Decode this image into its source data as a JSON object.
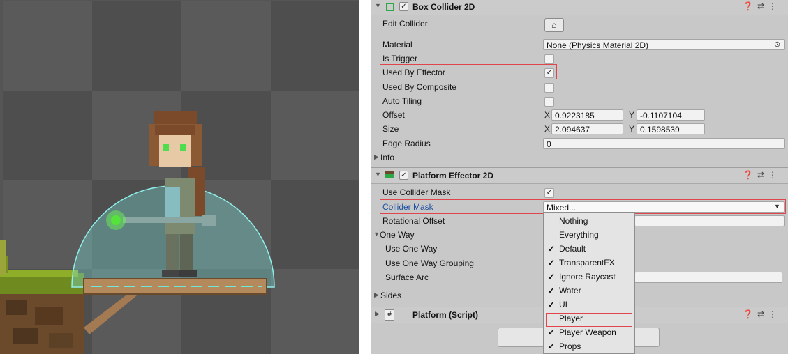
{
  "box_collider": {
    "title": "Box Collider 2D",
    "edit_collider": "Edit Collider",
    "material_label": "Material",
    "material_value": "None (Physics Material 2D)",
    "is_trigger": "Is Trigger",
    "used_by_effector": "Used By Effector",
    "used_by_composite": "Used By Composite",
    "auto_tiling": "Auto Tiling",
    "offset_label": "Offset",
    "offset_x": "0.9223185",
    "offset_y": "-0.1107104",
    "size_label": "Size",
    "size_x": "2.094637",
    "size_y": "0.1598539",
    "edge_radius_label": "Edge Radius",
    "edge_radius_value": "0",
    "info": "Info",
    "x": "X",
    "y": "Y",
    "check": "✓"
  },
  "platform_effector": {
    "title": "Platform Effector 2D",
    "use_collider_mask": "Use Collider Mask",
    "collider_mask": "Collider Mask",
    "collider_mask_value": "Mixed...",
    "rotational_offset": "Rotational Offset",
    "one_way": "One Way",
    "use_one_way": "Use One Way",
    "use_one_way_grouping": "Use One Way Grouping",
    "surface_arc": "Surface Arc",
    "sides": "Sides"
  },
  "platform_script": {
    "title": "Platform (Script)"
  },
  "dropdown": {
    "items": [
      {
        "label": "Nothing",
        "checked": false
      },
      {
        "label": "Everything",
        "checked": false
      },
      {
        "label": "Default",
        "checked": true
      },
      {
        "label": "TransparentFX",
        "checked": true
      },
      {
        "label": "Ignore Raycast",
        "checked": true
      },
      {
        "label": "Water",
        "checked": true
      },
      {
        "label": "UI",
        "checked": true
      },
      {
        "label": "Player",
        "checked": false
      },
      {
        "label": "Player Weapon",
        "checked": true
      },
      {
        "label": "Props",
        "checked": true
      }
    ]
  },
  "colors": {
    "highlight": "#e0444c",
    "collider_gizmo": "#7fe6e0",
    "link_blue": "#1b4fa3"
  }
}
